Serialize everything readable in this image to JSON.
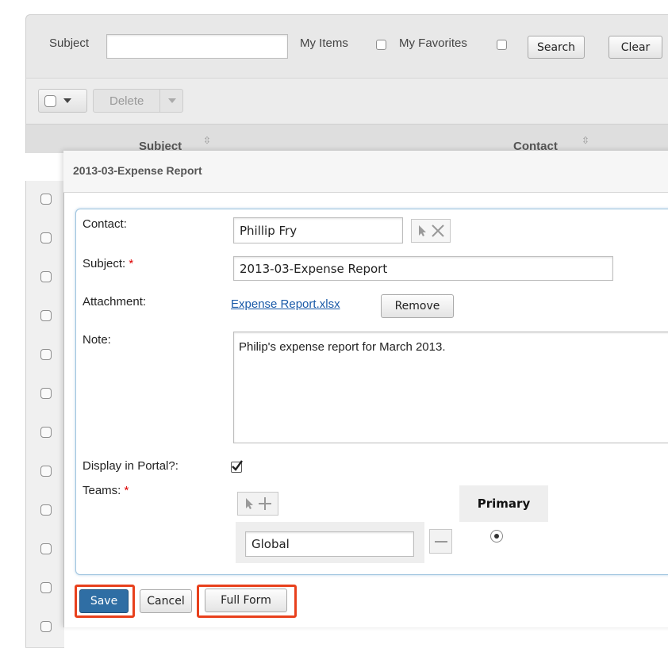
{
  "search": {
    "subject_label": "Subject",
    "subject_value": "",
    "my_items_label": "My Items",
    "my_favorites_label": "My Favorites",
    "search_button": "Search",
    "clear_button": "Clear"
  },
  "action_bar": {
    "delete_button": "Delete"
  },
  "list_header": {
    "subject_col": "Subject",
    "contact_col": "Contact",
    "sort_icon": "sort-arrows-icon"
  },
  "modal": {
    "title": "2013-03-Expense Report",
    "contact_label": "Contact:",
    "contact_value": "Phillip Fry",
    "subject_label": "Subject:",
    "subject_value": "2013-03-Expense Report",
    "required_mark": "*",
    "attachment_label": "Attachment:",
    "attachment_link": "Expense Report.xlsx",
    "remove_button": "Remove",
    "note_label": "Note:",
    "note_value": "Philip's expense report for March 2013.",
    "display_portal_label": "Display in Portal?:",
    "display_portal_checked": true,
    "teams_label": "Teams:",
    "team_value": "Global",
    "primary_header": "Primary",
    "save_button": "Save",
    "cancel_button": "Cancel",
    "full_form_button": "Full Form"
  },
  "colors": {
    "save_bg": "#2f6ea4",
    "highlight": "#e8401c",
    "link": "#1a5aa8"
  }
}
